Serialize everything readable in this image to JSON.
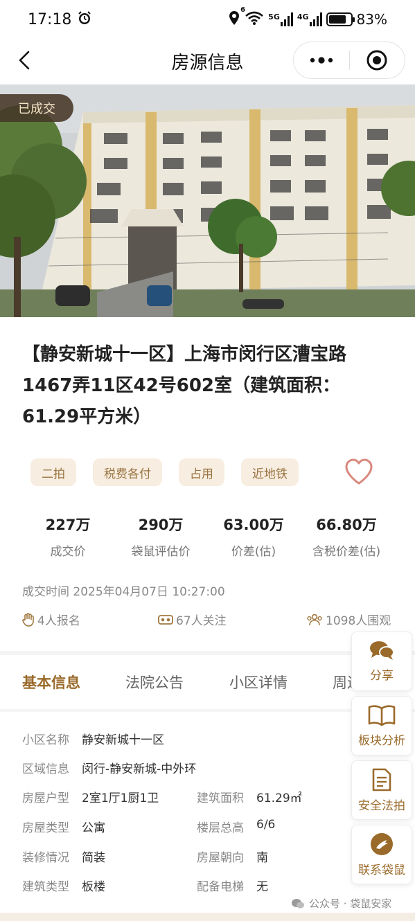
{
  "status_bar": {
    "time": "17:18",
    "network_5g": "5G",
    "network_4g": "4G",
    "wifi_badge": "6",
    "battery_percent": "83%",
    "battery_level": 0.83
  },
  "nav": {
    "title": "房源信息"
  },
  "hero": {
    "badge": "已成交"
  },
  "listing": {
    "title": "【静安新城十一区】上海市闵行区漕宝路1467弄11区42号602室（建筑面积：61.29平方米）"
  },
  "tags": [
    "二拍",
    "税费各付",
    "占用",
    "近地铁"
  ],
  "stats": [
    {
      "value": "227万",
      "label": "成交价"
    },
    {
      "value": "290万",
      "label": "袋鼠评估价"
    },
    {
      "value": "63.00万",
      "label": "价差(估)"
    },
    {
      "value": "66.80万",
      "label": "含税价差(估)"
    }
  ],
  "deal_time": "成交时间 2025年04月07日 10:27:00",
  "engagement": {
    "signups": "4人报名",
    "followers": "67人关注",
    "viewers": "1098人围观"
  },
  "tabs": [
    "基本信息",
    "法院公告",
    "小区详情",
    "周边"
  ],
  "basic_info": {
    "community_label": "小区名称",
    "community_value": "静安新城十一区",
    "area_label": "区域信息",
    "area_value": "闵行-静安新城-中外环",
    "layout_label": "房屋户型",
    "layout_value": "2室1厅1厨1卫",
    "size_label": "建筑面积",
    "size_value": "61.29㎡",
    "type_label": "房屋类型",
    "type_value": "公寓",
    "floor_label": "楼层总高",
    "floor_value": "6/6",
    "decor_label": "装修情况",
    "decor_value": "简装",
    "orient_label": "房屋朝向",
    "orient_value": "南",
    "build_label": "建筑类型",
    "build_value": "板楼",
    "elevator_label": "配备电梯",
    "elevator_value": "无"
  },
  "float_actions": {
    "share": "分享",
    "sector": "板块分析",
    "safe": "安全法拍",
    "contact": "联系袋鼠"
  },
  "watermark": "公众号 · 袋鼠安家",
  "colors": {
    "accent": "#9a6a2a",
    "tag_bg": "#f7ede0",
    "badge_bg": "#463728"
  }
}
